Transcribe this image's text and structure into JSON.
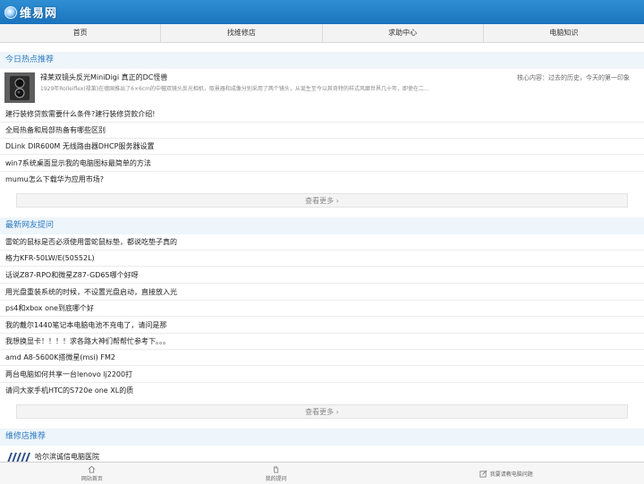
{
  "header": {
    "logo_text": "维易网"
  },
  "nav": [
    "首页",
    "找维修店",
    "求助中心",
    "电脑知识"
  ],
  "hot": {
    "title": "今日热点推荐",
    "featured": {
      "title": "禄莱双镜头反光MiniDigi 真正的DC怪兽",
      "desc": "1929年Rolleiflex(禄莱)在德国推出了6×6cm的中幅双镜头反光相机，取景器和成像分别采用了两个镜头，从诞生至今以其奇特的样式风靡世界几十年，即使在二…",
      "side": "核心内容：过去的历史，今天的第一印象"
    },
    "items": [
      "建行装修贷款需要什么条件?建行装修贷款介绍!",
      "全局热备和局部热备有哪些区别",
      "DLink DIR600M 无线路由器DHCP服务器设置",
      "win7系统桌面显示我的电脑图标最简单的方法",
      "mumu怎么下载华为应用市场?"
    ],
    "more": "查看更多"
  },
  "questions": {
    "title": "最新网友提问",
    "items": [
      "雷蛇的鼠标是否必须使用雷蛇鼠标垫，都说吃垫子真的",
      "格力KFR-50LW/E(50552L)",
      "话说Z87-RPO和微星Z87-GD65哪个好呀",
      "用光盘重装系统的时候，不设置光盘启动，直接放入光",
      "ps4和xbox one到底哪个好",
      "我的戴尔1440笔记本电脑电池不充电了，请问是那",
      "我想换显卡！！！！求各路大神们帮帮忙参考下。。。",
      "amd A8-5600K搭微星(msi) FM2",
      "两台电脑如何共享一台lenovo lj2200打",
      "请问大家手机HTC的S720e one XL的质"
    ],
    "more": "查看更多"
  },
  "shops": {
    "title": "维修店推荐",
    "name": "哈尔滨诚信电脑医院"
  },
  "tabbar": {
    "home": "网站首页",
    "mine": "我的提问",
    "ask": "我要请教电脑问题"
  },
  "colors": {
    "brand": "#1a73bd",
    "section": "#2c7bc0"
  },
  "icons": {
    "arrow": "chevron-right-icon",
    "home": "home-icon",
    "hand": "hand-icon",
    "edit": "edit-icon"
  }
}
